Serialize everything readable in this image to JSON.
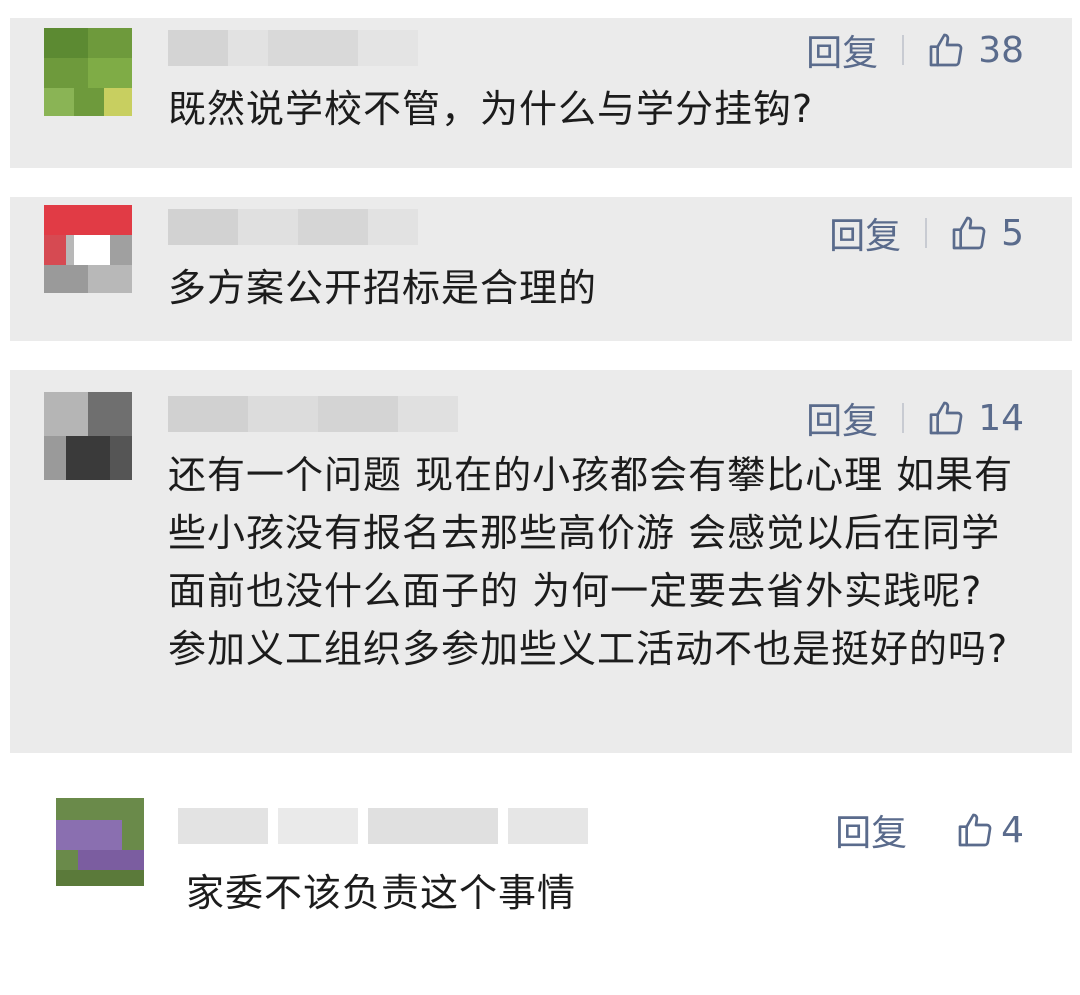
{
  "comments": [
    {
      "reply_label": "回复",
      "like_count": "38",
      "text": "既然说学校不管，为什么与学分挂钩?"
    },
    {
      "reply_label": "回复",
      "like_count": "5",
      "text": "多方案公开招标是合理的"
    },
    {
      "reply_label": "回复",
      "like_count": "14",
      "text": "还有一个问题 现在的小孩都会有攀比心理 如果有些小孩没有报名去那些高价游 会感觉以后在同学面前也没什么面子的 为何一定要去省外实践呢? 参加义工组织多参加些义工活动不也是挺好的吗?"
    },
    {
      "reply_label": "回复",
      "like_count": "4",
      "text": "家委不该负责这个事情"
    }
  ],
  "colors": {
    "card_background": "#ebebeb",
    "action_color": "#5a6b8c",
    "text_color": "#1c1c1c"
  },
  "icons": {
    "like": "thumbs-up-icon"
  }
}
